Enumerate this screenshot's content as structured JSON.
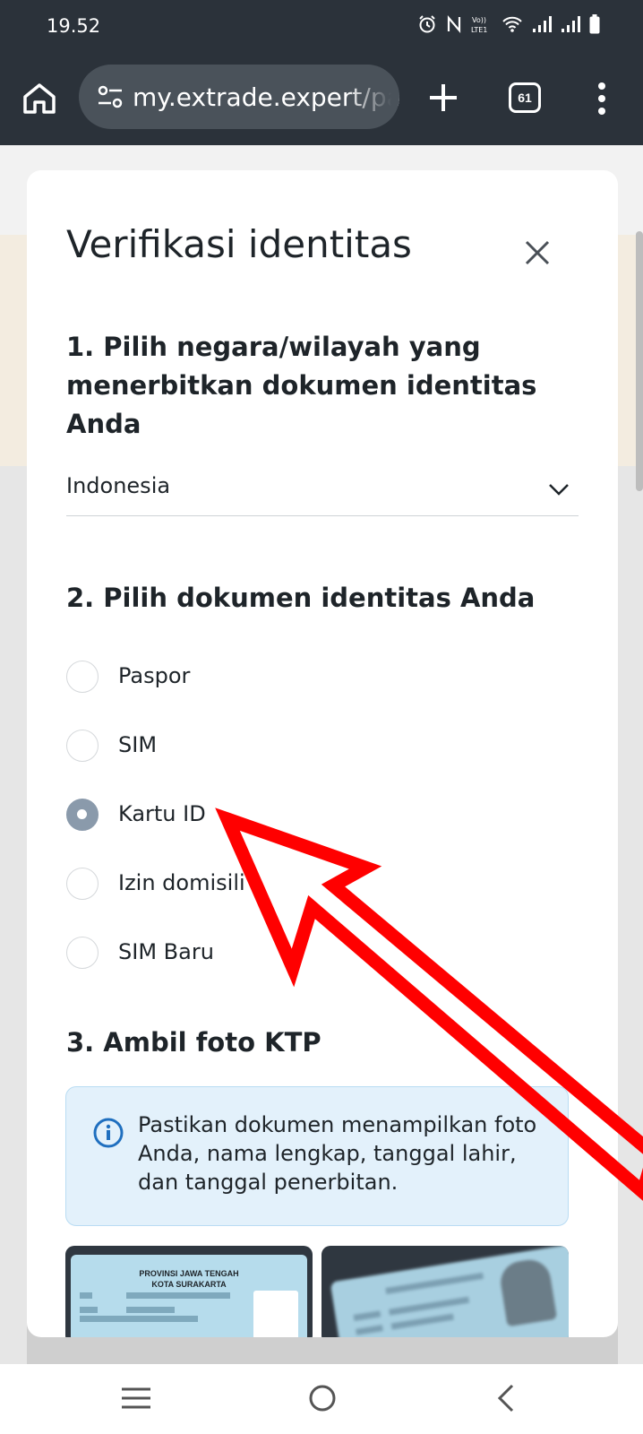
{
  "status_bar": {
    "time": "19.52",
    "icons": [
      "alarm-icon",
      "nfc-icon",
      "volte-icon",
      "wifi-icon",
      "signal-icon",
      "signal-icon",
      "battery-icon"
    ]
  },
  "browser": {
    "url": "my.extrade.expert/pa",
    "tab_count": "61"
  },
  "modal": {
    "title": "Verifikasi identitas",
    "step1": {
      "heading": "1. Pilih negara/wilayah yang menerbitkan dokumen identitas Anda",
      "selected_country": "Indonesia"
    },
    "step2": {
      "heading": "2. Pilih dokumen identitas Anda",
      "options": [
        {
          "label": "Paspor",
          "checked": false
        },
        {
          "label": "SIM",
          "checked": false
        },
        {
          "label": "Kartu ID",
          "checked": true
        },
        {
          "label": "Izin domisili",
          "checked": false
        },
        {
          "label": "SIM Baru",
          "checked": false
        }
      ]
    },
    "step3": {
      "heading": "3. Ambil foto KTP",
      "info": "Pastikan dokumen menampilkan foto Anda, nama lengkap, tanggal lahir, dan tanggal penerbitan.",
      "sample_card": {
        "line1": "PROVINSI JAWA TENGAH",
        "line2": "KOTA SURAKARTA"
      }
    }
  },
  "colors": {
    "chrome_dark": "#2b323a",
    "radio_checked": "#8a9aab",
    "info_bg": "#e3f1fb",
    "info_accent": "#1f6fbf",
    "annotation_red": "#ff0000"
  }
}
